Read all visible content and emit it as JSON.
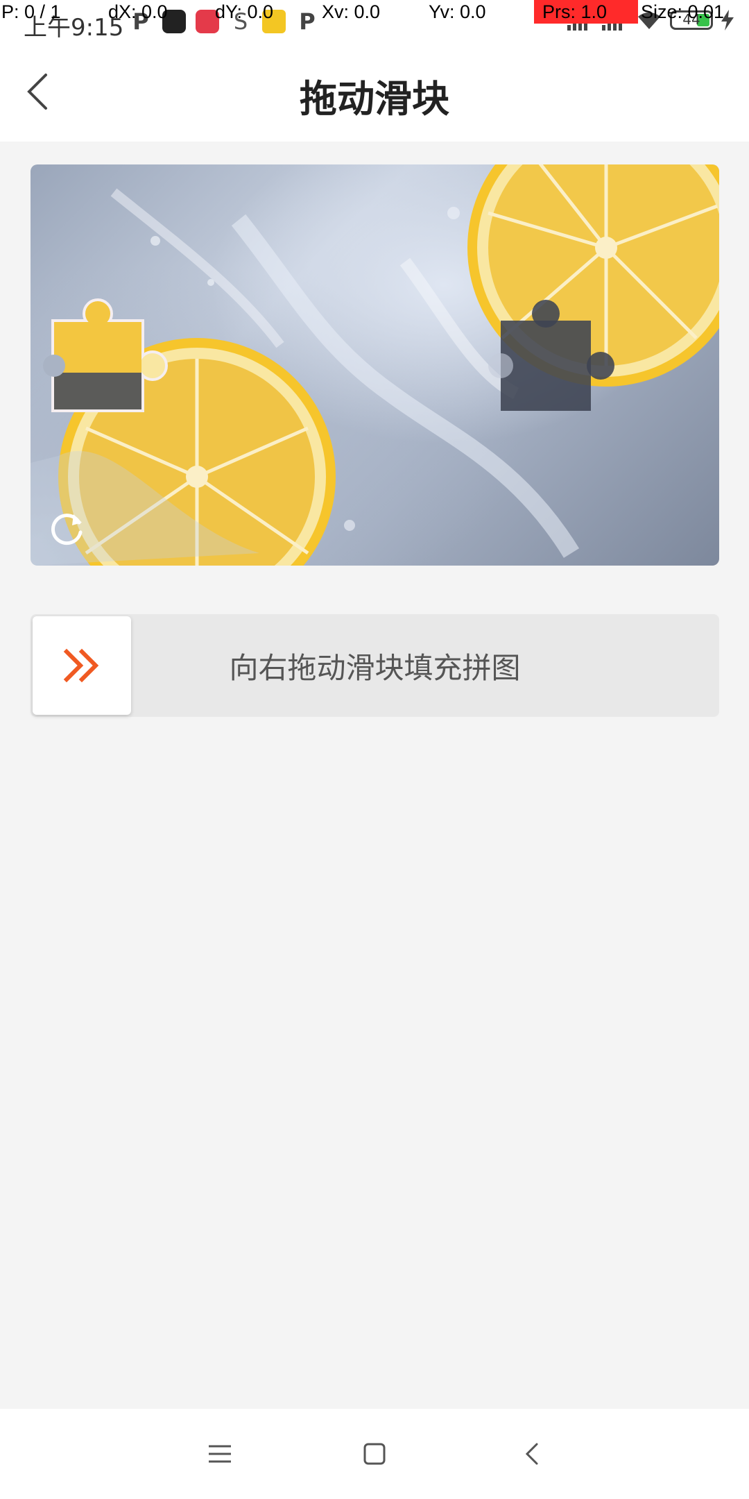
{
  "status_bar": {
    "time": "上午9:15",
    "battery_level": "44",
    "icons": [
      "p-icon",
      "tiktok-icon",
      "red-app-icon",
      "sw-icon",
      "taxi-icon",
      "p-icon"
    ]
  },
  "debug_overlay": {
    "p": "P: 0 / 1",
    "dx": "dX: 0.0",
    "dy": "dY: 0.0",
    "xv": "Xv: 0.0",
    "yv": "Yv: 0.0",
    "prs": "Prs: 1.0",
    "size": "Size: 0.01"
  },
  "header": {
    "title": "拖动滑块"
  },
  "captcha": {
    "slider_hint": "向右拖动滑块填充拼图",
    "accent_color": "#f05a22"
  },
  "nav_bar": {
    "buttons": [
      "menu-icon",
      "home-icon",
      "back-icon"
    ]
  }
}
